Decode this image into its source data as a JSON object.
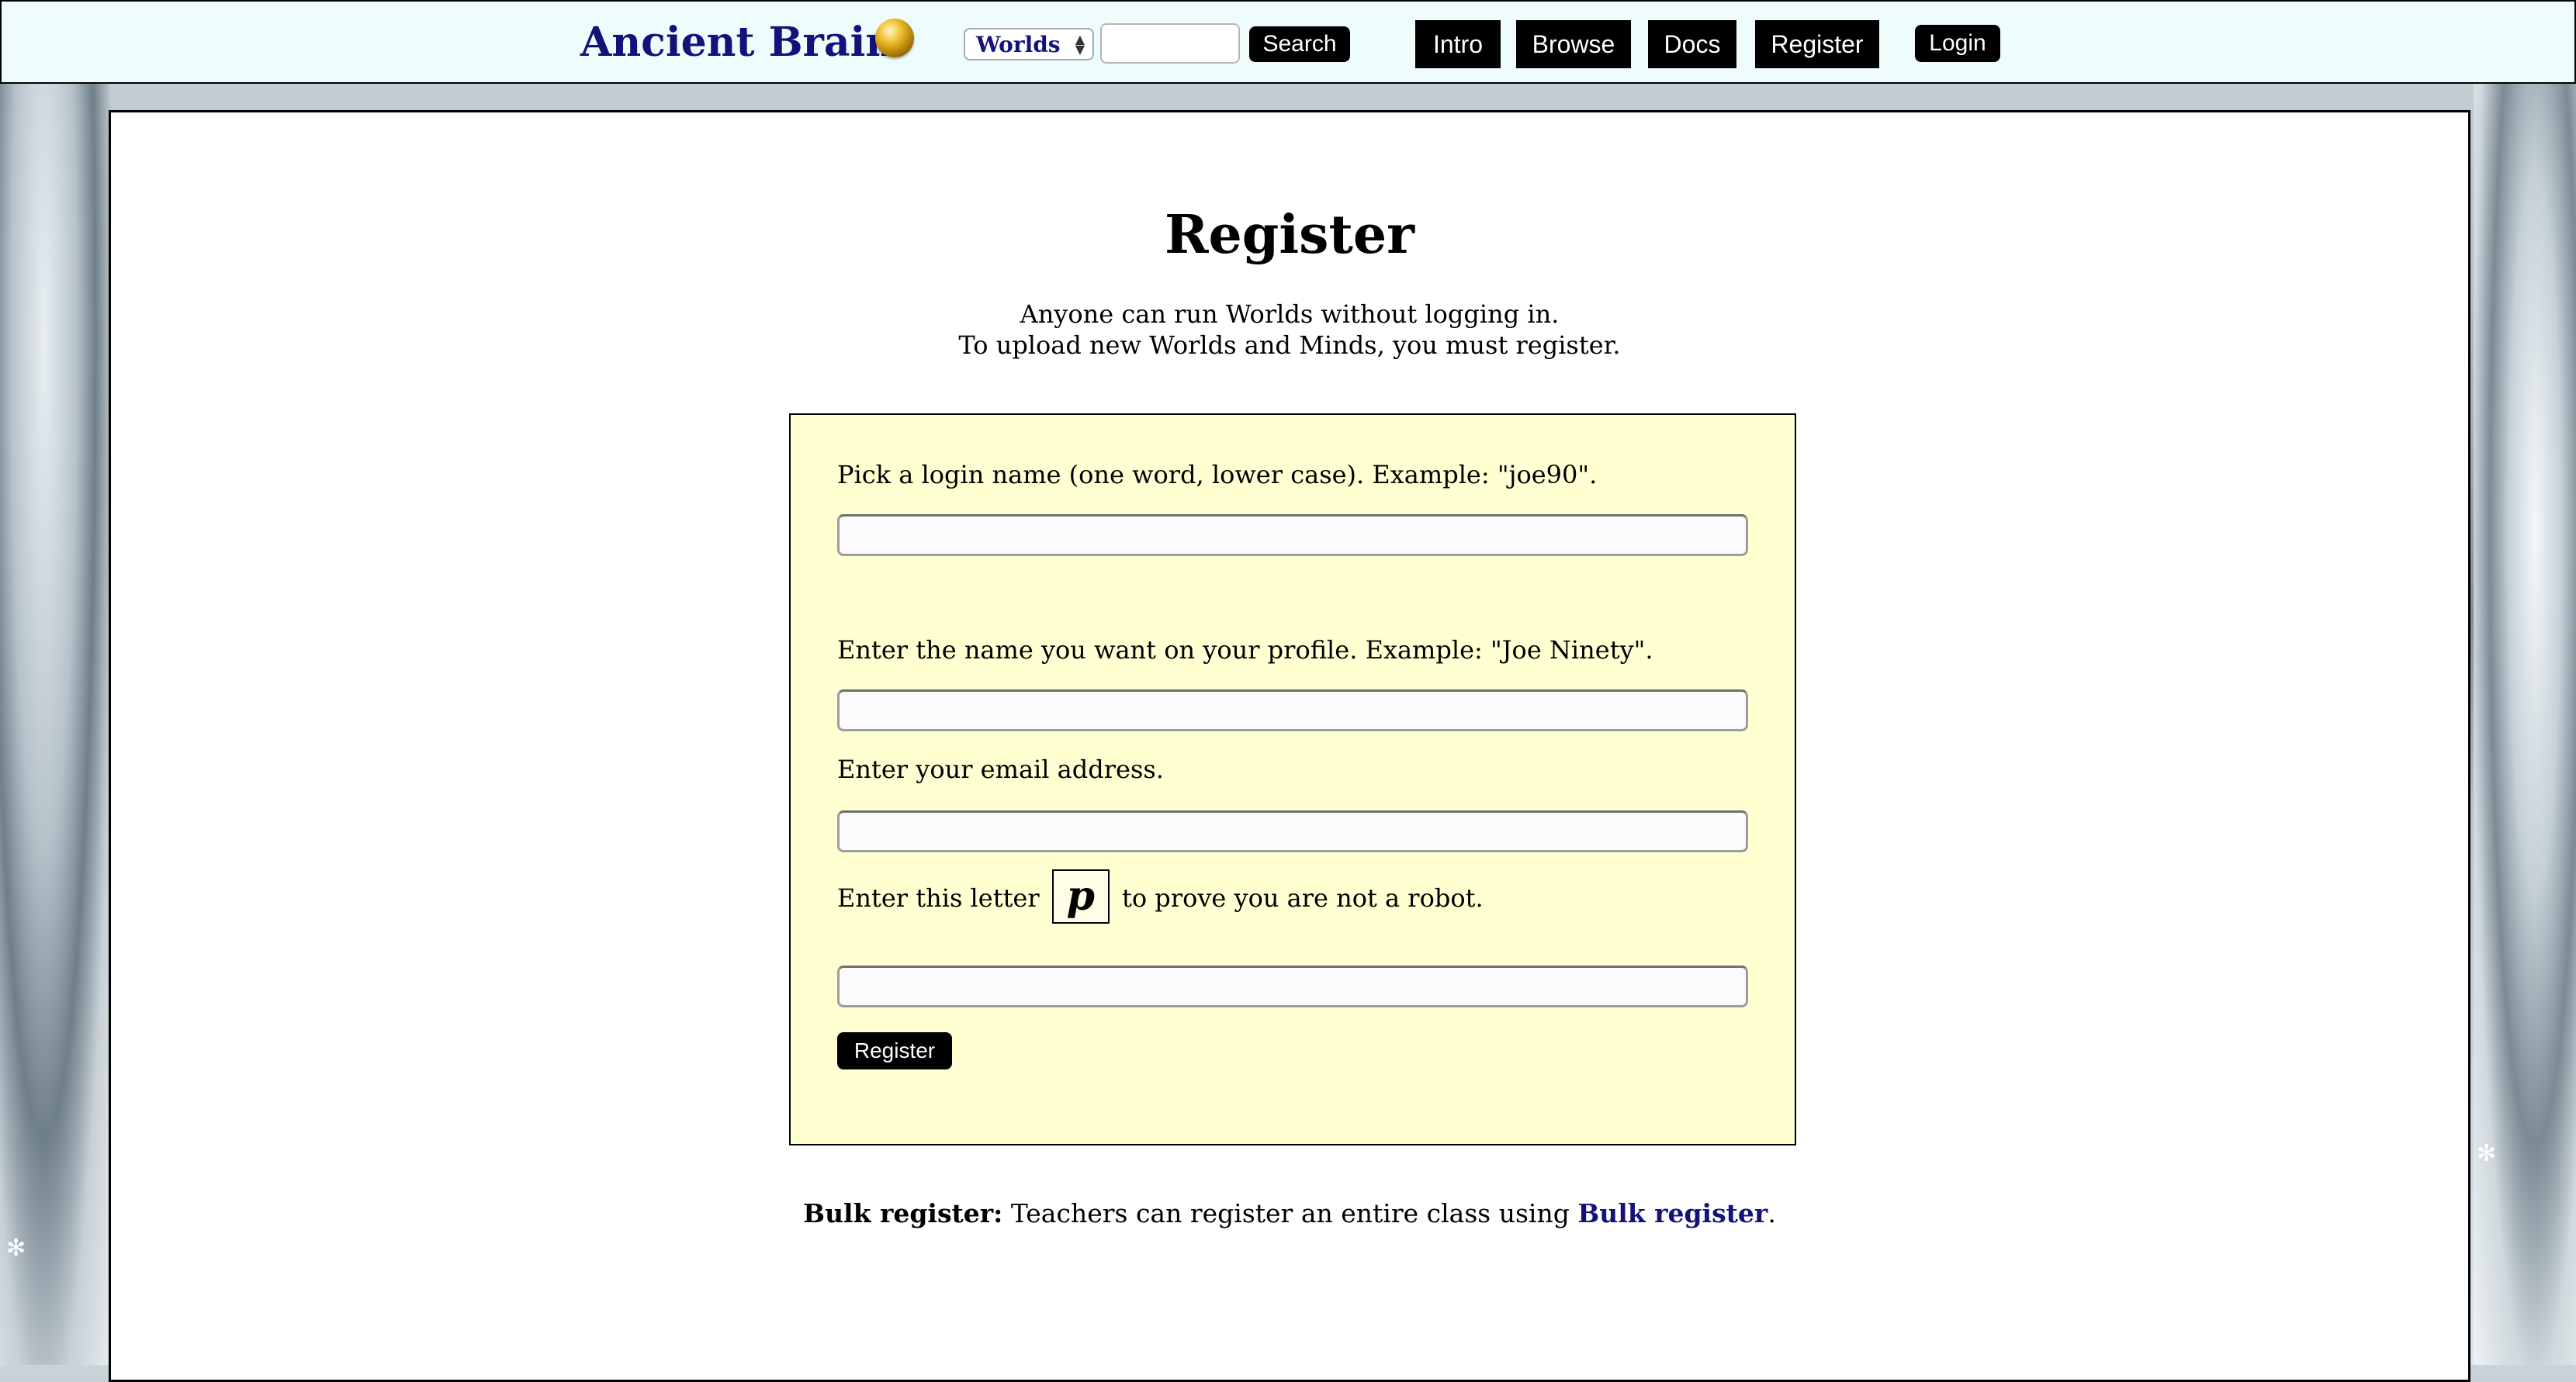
{
  "brand": {
    "title": "Ancient Brain",
    "logo_icon": "globe-icon"
  },
  "header": {
    "select_value": "Worlds",
    "search_value": "",
    "search_button": "Search",
    "nav": [
      "Intro",
      "Browse",
      "Docs",
      "Register"
    ],
    "login": "Login"
  },
  "page": {
    "title": "Register",
    "intro_line1": "Anyone can run Worlds without logging in.",
    "intro_line2": "To upload new Worlds and Minds, you must register."
  },
  "form": {
    "login_label": "Pick a login name (one word, lower case). Example: \"joe90\".",
    "login_value": "",
    "profile_label": "Enter the name you want on your profile. Example: \"Joe Ninety\".",
    "profile_value": "",
    "email_label": "Enter your email address.",
    "email_value": "",
    "captcha_prefix": "Enter this letter",
    "captcha_letter": "p",
    "captcha_suffix": "to prove you are not a robot.",
    "captcha_value": "",
    "submit": "Register",
    "box_color": "#ffffd1"
  },
  "footer": {
    "bulk_heading": "Bulk register:",
    "bulk_text": "Teachers can register an entire class using",
    "bulk_link": "Bulk register",
    "bulk_end": "."
  },
  "colors": {
    "brand": "#14117a",
    "topbar": "#effcfc",
    "button": "#000000"
  }
}
